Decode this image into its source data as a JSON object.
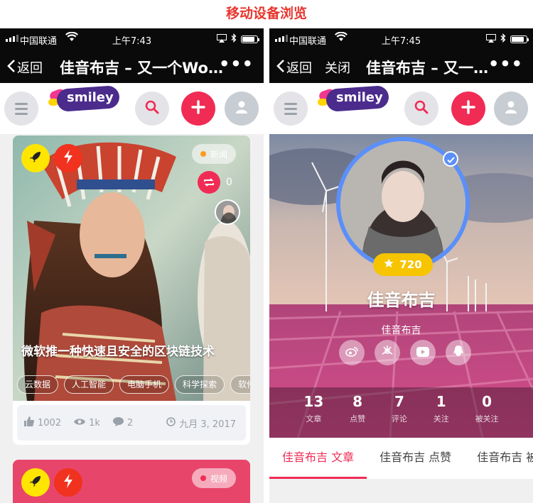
{
  "page_title": "移动设备浏览",
  "left_phone": {
    "status": {
      "carrier": "中国联通",
      "time": "上午7:43"
    },
    "nav": {
      "back_label": "返回",
      "title": "佳音布吉 – 又一个Wor…",
      "more": "•••"
    },
    "header": {
      "logo_text": "smiley"
    },
    "card1": {
      "pill_label": "新闻",
      "repost_count": "0",
      "title": "微软推一种快速且安全的区块链技术",
      "tags": [
        "云数据",
        "人工智能",
        "电脑手机",
        "科学探索",
        "软件"
      ],
      "likes": "1002",
      "views": "1k",
      "comments": "2",
      "date": "九月 3, 2017"
    },
    "card2": {
      "pill_label": "视频"
    }
  },
  "right_phone": {
    "status": {
      "carrier": "中国联通",
      "time": "上午7:45"
    },
    "nav": {
      "back_label": "返回",
      "close_label": "关闭",
      "title": "佳音布吉 – 又一…",
      "more": "•••"
    },
    "header": {
      "logo_text": "smiley"
    },
    "profile": {
      "score": "720",
      "name": "佳音布吉",
      "subname": "佳音布吉",
      "stats": [
        {
          "value": "13",
          "label": "文章"
        },
        {
          "value": "8",
          "label": "点赞"
        },
        {
          "value": "7",
          "label": "评论"
        },
        {
          "value": "1",
          "label": "关注"
        },
        {
          "value": "0",
          "label": "被关注"
        }
      ]
    },
    "tabs": [
      "佳音布吉 文章",
      "佳音布吉 点赞",
      "佳音布吉 被"
    ]
  },
  "colors": {
    "accent": "#f02c55",
    "title_red": "#e8362d",
    "ring_blue": "#5b8ff9",
    "badge_yellow": "#f7c400",
    "rocket_yellow": "#ffe600"
  }
}
